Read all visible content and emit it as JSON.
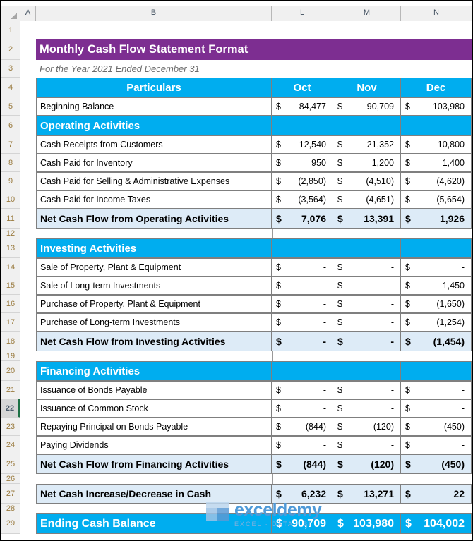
{
  "spreadsheet": {
    "column_headers": [
      "A",
      "B",
      "L",
      "M",
      "N"
    ],
    "select_all_icon": "select-all-triangle-icon",
    "active_row": "22",
    "row_numbers": [
      "1",
      "2",
      "3",
      "4",
      "5",
      "6",
      "7",
      "8",
      "9",
      "10",
      "11",
      "12",
      "13",
      "14",
      "15",
      "16",
      "17",
      "18",
      "19",
      "20",
      "21",
      "22",
      "23",
      "24",
      "25",
      "26",
      "27",
      "28",
      "29"
    ]
  },
  "colors": {
    "title_purple": "#7D2E91",
    "header_cyan": "#00ADEF",
    "subtotal_blue": "#DDEBF7",
    "grid_line": "#7F7F7F",
    "row_header_gray": "#F0F0F0",
    "active_row_accent": "#1E7145"
  },
  "report": {
    "title": "Monthly Cash Flow Statement Format",
    "subtitle": "For the Year 2021 Ended December 31",
    "column_header_label": "Particulars",
    "months": [
      "Oct",
      "Nov",
      "Dec"
    ],
    "currency_symbol": "$",
    "zero_display": "-"
  },
  "rows": {
    "beginning_balance": {
      "label": "Beginning Balance",
      "values": [
        "84,477",
        "90,709",
        "103,980"
      ]
    },
    "operating_section": {
      "label": "Operating Activities"
    },
    "operating_items": [
      {
        "label": "Cash Receipts from Customers",
        "values": [
          "12,540",
          "21,352",
          "10,800"
        ]
      },
      {
        "label": "Cash Paid for Inventory",
        "values": [
          "950",
          "1,200",
          "1,400"
        ]
      },
      {
        "label": "Cash Paid for Selling & Administrative Expenses",
        "values": [
          "(2,850)",
          "(4,510)",
          "(4,620)"
        ]
      },
      {
        "label": "Cash Paid for Income Taxes",
        "values": [
          "(3,564)",
          "(4,651)",
          "(5,654)"
        ]
      }
    ],
    "operating_total": {
      "label": "Net Cash Flow from Operating Activities",
      "values": [
        "7,076",
        "13,391",
        "1,926"
      ]
    },
    "investing_section": {
      "label": "Investing Activities"
    },
    "investing_items": [
      {
        "label": "Sale of Property, Plant & Equipment",
        "values": [
          "-",
          "-",
          "-"
        ]
      },
      {
        "label": "Sale of Long-term Investments",
        "values": [
          "-",
          "-",
          "1,450"
        ]
      },
      {
        "label": "Purchase of Property, Plant & Equipment",
        "values": [
          "-",
          "-",
          "(1,650)"
        ]
      },
      {
        "label": "Purchase of Long-term Investments",
        "values": [
          "-",
          "-",
          "(1,254)"
        ]
      }
    ],
    "investing_total": {
      "label": "Net Cash Flow from Investing Activities",
      "values": [
        "-",
        "-",
        "(1,454)"
      ]
    },
    "financing_section": {
      "label": "Financing Activities"
    },
    "financing_items": [
      {
        "label": "Issuance of Bonds Payable",
        "values": [
          "-",
          "-",
          "-"
        ]
      },
      {
        "label": "Issuance of Common Stock",
        "values": [
          "-",
          "-",
          "-"
        ]
      },
      {
        "label": "Repaying Principal on Bonds Payable",
        "values": [
          "(844)",
          "(120)",
          "(450)"
        ]
      },
      {
        "label": "Paying Dividends",
        "values": [
          "-",
          "-",
          "-"
        ]
      }
    ],
    "financing_total": {
      "label": "Net Cash Flow from Financing Activities",
      "values": [
        "(844)",
        "(120)",
        "(450)"
      ]
    },
    "net_change": {
      "label": "Net Cash Increase/Decrease in Cash",
      "values": [
        "6,232",
        "13,271",
        "22"
      ]
    },
    "ending_balance": {
      "label": "Ending Cash Balance",
      "values": [
        "90,709",
        "103,980",
        "104,002"
      ]
    }
  },
  "watermark": {
    "name": "exceldemy",
    "tagline": "EXCEL · DATA · BI"
  }
}
